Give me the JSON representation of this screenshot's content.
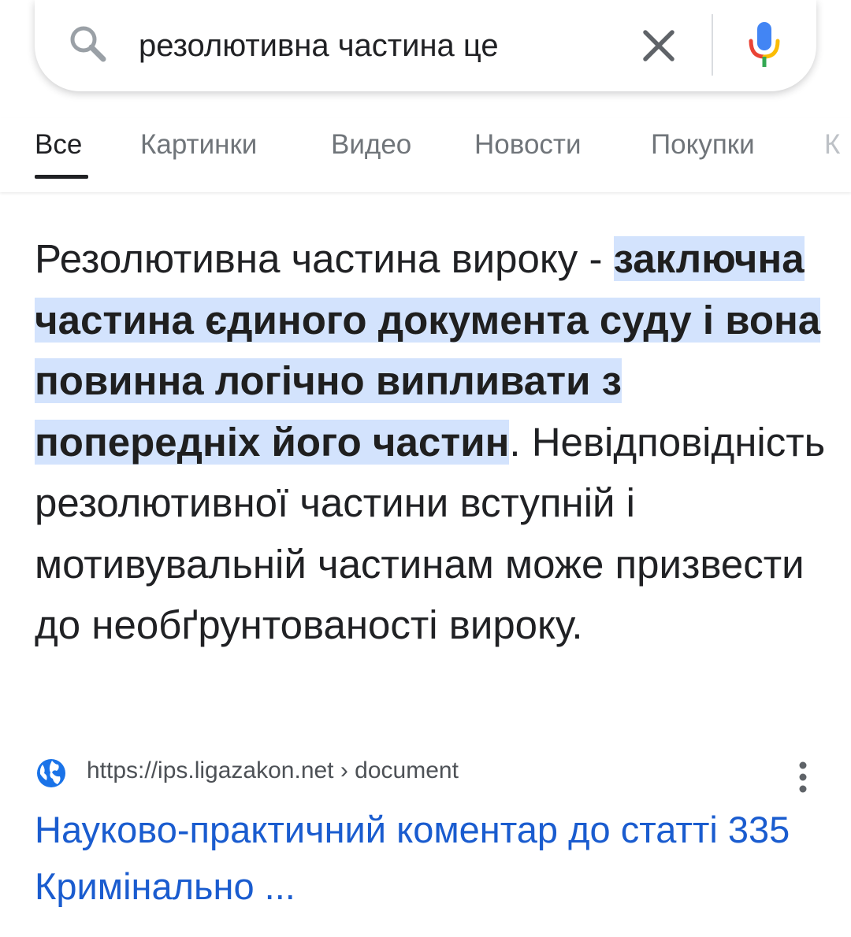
{
  "search": {
    "query": "резолютивна частина це"
  },
  "icons": {
    "search": "search-icon",
    "clear": "close-icon",
    "mic": "microphone-icon",
    "site": "globe-icon",
    "more": "more-vert-icon"
  },
  "tabs": [
    {
      "label": "Все",
      "active": true
    },
    {
      "label": "Картинки",
      "active": false
    },
    {
      "label": "Видео",
      "active": false
    },
    {
      "label": "Новости",
      "active": false
    },
    {
      "label": "Покупки",
      "active": false
    },
    {
      "label": "К",
      "active": false
    }
  ],
  "snippet": {
    "intro": "Резолютивна частина вироку - ",
    "highlight": "заключна частина єдиного документа суду і вона повинна логічно випливати з попередніх його частин",
    "rest": ". Невідповідність резолютивної частини вступній і мотивувальній частинам може призвести до необґрунтованості вироку."
  },
  "result": {
    "url": "https://ips.ligazakon.net › document",
    "title": "Науково-практичний коментар до статті 335 Кримінально ..."
  },
  "colors": {
    "highlight": "#d3e3fd",
    "link": "#1a5ccf",
    "text": "#202124",
    "muted": "#70757a",
    "google_blue": "#4285f4",
    "google_red": "#ea4335",
    "google_yellow": "#fbbc04",
    "google_green": "#34a853"
  }
}
